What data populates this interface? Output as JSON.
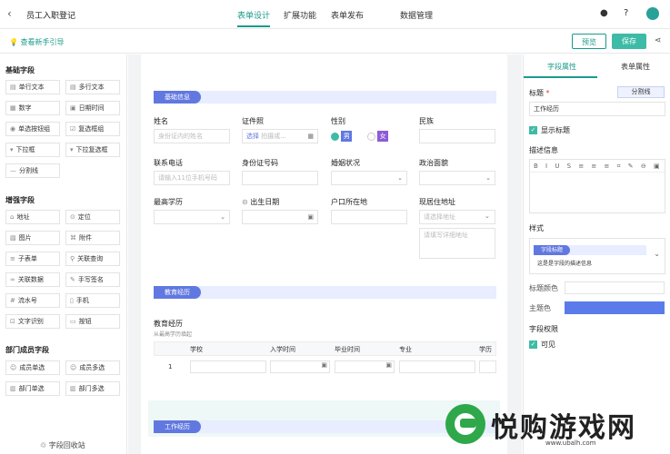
{
  "header": {
    "title": "员工入职登记",
    "tabs": [
      "表单设计",
      "扩展功能",
      "表单发布",
      "数据管理"
    ]
  },
  "subbar": {
    "guide": "查看新手引导",
    "preview": "预览",
    "save": "保存"
  },
  "left": {
    "basic_title": "基础字段",
    "basic": [
      "单行文本",
      "多行文本",
      "数字",
      "日期时间",
      "单选按钮组",
      "复选框组",
      "下拉框",
      "下拉复选框",
      "分割线"
    ],
    "enhanced_title": "增强字段",
    "enhanced": [
      "地址",
      "定位",
      "图片",
      "附件",
      "子表单",
      "关联查询",
      "关联数据",
      "手写签名",
      "流水号",
      "手机",
      "文字识别",
      "按钮"
    ],
    "dept_title": "部门成员字段",
    "dept": [
      "成员单选",
      "成员多选",
      "部门单选",
      "部门多选"
    ],
    "recycle": "字段回收站"
  },
  "form": {
    "sec1": "基础信息",
    "name": "姓名",
    "name_ph": "身份证内的姓名",
    "idtype": "证件照",
    "idtype_select": "选择",
    "idtype_ph": "拍摄或...",
    "gender": "性别",
    "male": "男",
    "female": "女",
    "ethnic": "民族",
    "phone": "联系电话",
    "phone_ph": "请输入11位手机号码",
    "idno": "身份证号码",
    "marital": "婚姻状况",
    "political": "政治面貌",
    "edu": "最高学历",
    "birth": "出生日期",
    "hukou": "户口所在地",
    "addr": "现居住地址",
    "addr_ph": "请选择地址",
    "addr_detail_ph": "请填写详细地址",
    "sec2": "教育经历",
    "edu_title": "教育经历",
    "edu_sub": "从最高学历填起",
    "cols": [
      "学校",
      "入学时间",
      "毕业时间",
      "专业",
      "学历"
    ],
    "row": "1",
    "sec3": "工作经历"
  },
  "right": {
    "tab1": "字段属性",
    "tab2": "表单属性",
    "title_label": "标题",
    "required": "*",
    "divider": "分割线",
    "title_value": "工作经历",
    "show_title": "显示标题",
    "desc": "描述信息",
    "style": "样式",
    "style_tag": "字段标题",
    "style_desc": "这是是字段的描述信息",
    "title_color": "标题颜色",
    "theme_color": "主题色",
    "perm": "字段权限",
    "visible": "可见"
  },
  "watermark": {
    "text": "悦购游戏网",
    "url": "www.ubalh.com"
  }
}
